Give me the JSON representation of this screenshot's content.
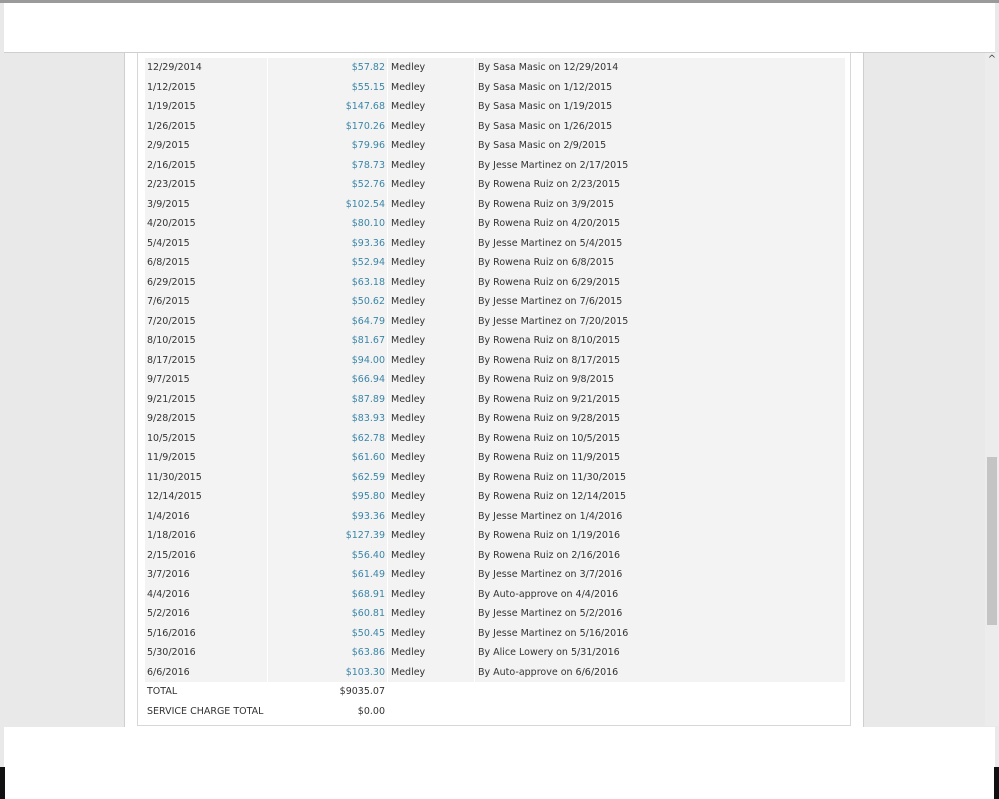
{
  "ui": {
    "scroll_up_glyph": "^",
    "colors": {
      "amount_link": "#3a86a8",
      "row_shade": "#f3f3f3"
    }
  },
  "rows": [
    {
      "date": "12/29/2014",
      "amount": "$57.82",
      "vendor": "Medley",
      "approval": "By Sasa Masic on 12/29/2014"
    },
    {
      "date": "1/12/2015",
      "amount": "$55.15",
      "vendor": "Medley",
      "approval": "By Sasa Masic on 1/12/2015"
    },
    {
      "date": "1/19/2015",
      "amount": "$147.68",
      "vendor": "Medley",
      "approval": "By Sasa Masic on 1/19/2015"
    },
    {
      "date": "1/26/2015",
      "amount": "$170.26",
      "vendor": "Medley",
      "approval": "By Sasa Masic on 1/26/2015"
    },
    {
      "date": "2/9/2015",
      "amount": "$79.96",
      "vendor": "Medley",
      "approval": "By Sasa Masic on 2/9/2015"
    },
    {
      "date": "2/16/2015",
      "amount": "$78.73",
      "vendor": "Medley",
      "approval": "By Jesse Martinez on 2/17/2015"
    },
    {
      "date": "2/23/2015",
      "amount": "$52.76",
      "vendor": "Medley",
      "approval": "By Rowena Ruiz on 2/23/2015"
    },
    {
      "date": "3/9/2015",
      "amount": "$102.54",
      "vendor": "Medley",
      "approval": "By Rowena Ruiz on 3/9/2015"
    },
    {
      "date": "4/20/2015",
      "amount": "$80.10",
      "vendor": "Medley",
      "approval": "By Rowena Ruiz on 4/20/2015"
    },
    {
      "date": "5/4/2015",
      "amount": "$93.36",
      "vendor": "Medley",
      "approval": "By Jesse Martinez on 5/4/2015"
    },
    {
      "date": "6/8/2015",
      "amount": "$52.94",
      "vendor": "Medley",
      "approval": "By Rowena Ruiz on 6/8/2015"
    },
    {
      "date": "6/29/2015",
      "amount": "$63.18",
      "vendor": "Medley",
      "approval": "By Rowena Ruiz on 6/29/2015"
    },
    {
      "date": "7/6/2015",
      "amount": "$50.62",
      "vendor": "Medley",
      "approval": "By Jesse Martinez on 7/6/2015"
    },
    {
      "date": "7/20/2015",
      "amount": "$64.79",
      "vendor": "Medley",
      "approval": "By Jesse Martinez on 7/20/2015"
    },
    {
      "date": "8/10/2015",
      "amount": "$81.67",
      "vendor": "Medley",
      "approval": "By Rowena Ruiz on 8/10/2015"
    },
    {
      "date": "8/17/2015",
      "amount": "$94.00",
      "vendor": "Medley",
      "approval": "By Rowena Ruiz on 8/17/2015"
    },
    {
      "date": "9/7/2015",
      "amount": "$66.94",
      "vendor": "Medley",
      "approval": "By Rowena Ruiz on 9/8/2015"
    },
    {
      "date": "9/21/2015",
      "amount": "$87.89",
      "vendor": "Medley",
      "approval": "By Rowena Ruiz on 9/21/2015"
    },
    {
      "date": "9/28/2015",
      "amount": "$83.93",
      "vendor": "Medley",
      "approval": "By Rowena Ruiz on 9/28/2015"
    },
    {
      "date": "10/5/2015",
      "amount": "$62.78",
      "vendor": "Medley",
      "approval": "By Rowena Ruiz on 10/5/2015"
    },
    {
      "date": "11/9/2015",
      "amount": "$61.60",
      "vendor": "Medley",
      "approval": "By Rowena Ruiz on 11/9/2015"
    },
    {
      "date": "11/30/2015",
      "amount": "$62.59",
      "vendor": "Medley",
      "approval": "By Rowena Ruiz on 11/30/2015"
    },
    {
      "date": "12/14/2015",
      "amount": "$95.80",
      "vendor": "Medley",
      "approval": "By Rowena Ruiz on 12/14/2015"
    },
    {
      "date": "1/4/2016",
      "amount": "$93.36",
      "vendor": "Medley",
      "approval": "By Jesse Martinez on 1/4/2016"
    },
    {
      "date": "1/18/2016",
      "amount": "$127.39",
      "vendor": "Medley",
      "approval": "By Rowena Ruiz on 1/19/2016"
    },
    {
      "date": "2/15/2016",
      "amount": "$56.40",
      "vendor": "Medley",
      "approval": "By Rowena Ruiz on 2/16/2016"
    },
    {
      "date": "3/7/2016",
      "amount": "$61.49",
      "vendor": "Medley",
      "approval": "By Jesse Martinez on 3/7/2016"
    },
    {
      "date": "4/4/2016",
      "amount": "$68.91",
      "vendor": "Medley",
      "approval": "By Auto-approve on 4/4/2016"
    },
    {
      "date": "5/2/2016",
      "amount": "$60.81",
      "vendor": "Medley",
      "approval": "By Jesse Martinez on 5/2/2016"
    },
    {
      "date": "5/16/2016",
      "amount": "$50.45",
      "vendor": "Medley",
      "approval": "By Jesse Martinez on 5/16/2016"
    },
    {
      "date": "5/30/2016",
      "amount": "$63.86",
      "vendor": "Medley",
      "approval": "By Alice Lowery on 5/31/2016"
    },
    {
      "date": "6/6/2016",
      "amount": "$103.30",
      "vendor": "Medley",
      "approval": "By Auto-approve on 6/6/2016"
    }
  ],
  "totals": [
    {
      "label": "TOTAL",
      "value": "$9035.07"
    },
    {
      "label": "SERVICE CHARGE TOTAL",
      "value": "$0.00"
    }
  ]
}
